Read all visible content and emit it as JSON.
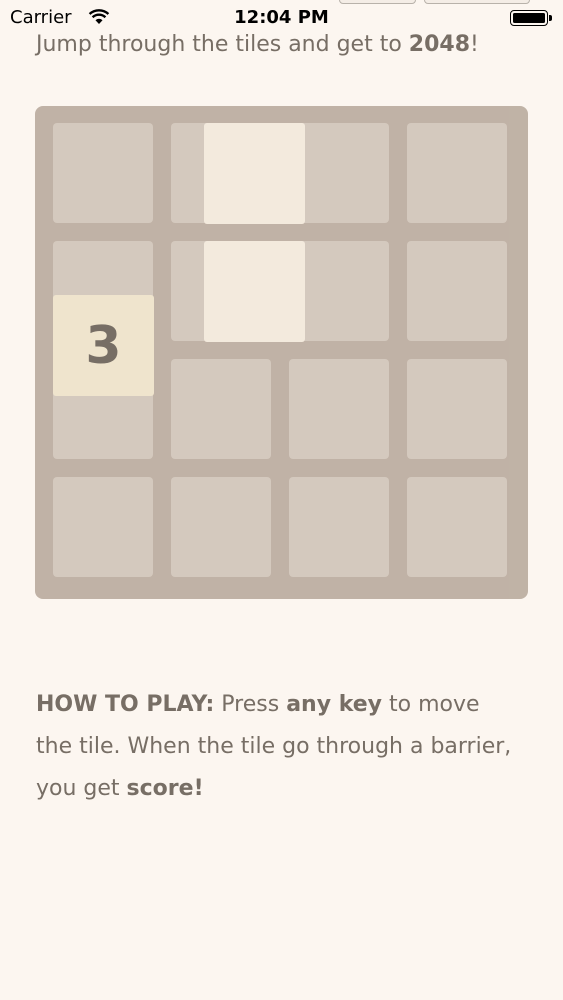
{
  "status_bar": {
    "carrier": "Carrier",
    "time": "12:04 PM"
  },
  "intro": {
    "text_before": "Jump through the tiles and get to ",
    "highlight": "2048",
    "text_after": "!"
  },
  "board": {
    "size": 4,
    "player_tile": {
      "value": "3",
      "row": 2,
      "col": 0
    },
    "barrier_tiles": [
      {
        "row": 0,
        "col": 1.3
      },
      {
        "row": 1,
        "col": 1.3
      }
    ]
  },
  "how_to_play": {
    "label": "HOW TO PLAY:",
    "t1": " Press ",
    "b1": "any key",
    "t2": " to move the tile. When the tile go through a barrier, you get ",
    "b2": "score!"
  },
  "colors": {
    "background": "#fcf6f0",
    "board": "#bbada0",
    "barrier": "#f3e9dc",
    "player_tile": "#efe4cd",
    "text": "#776e65"
  }
}
